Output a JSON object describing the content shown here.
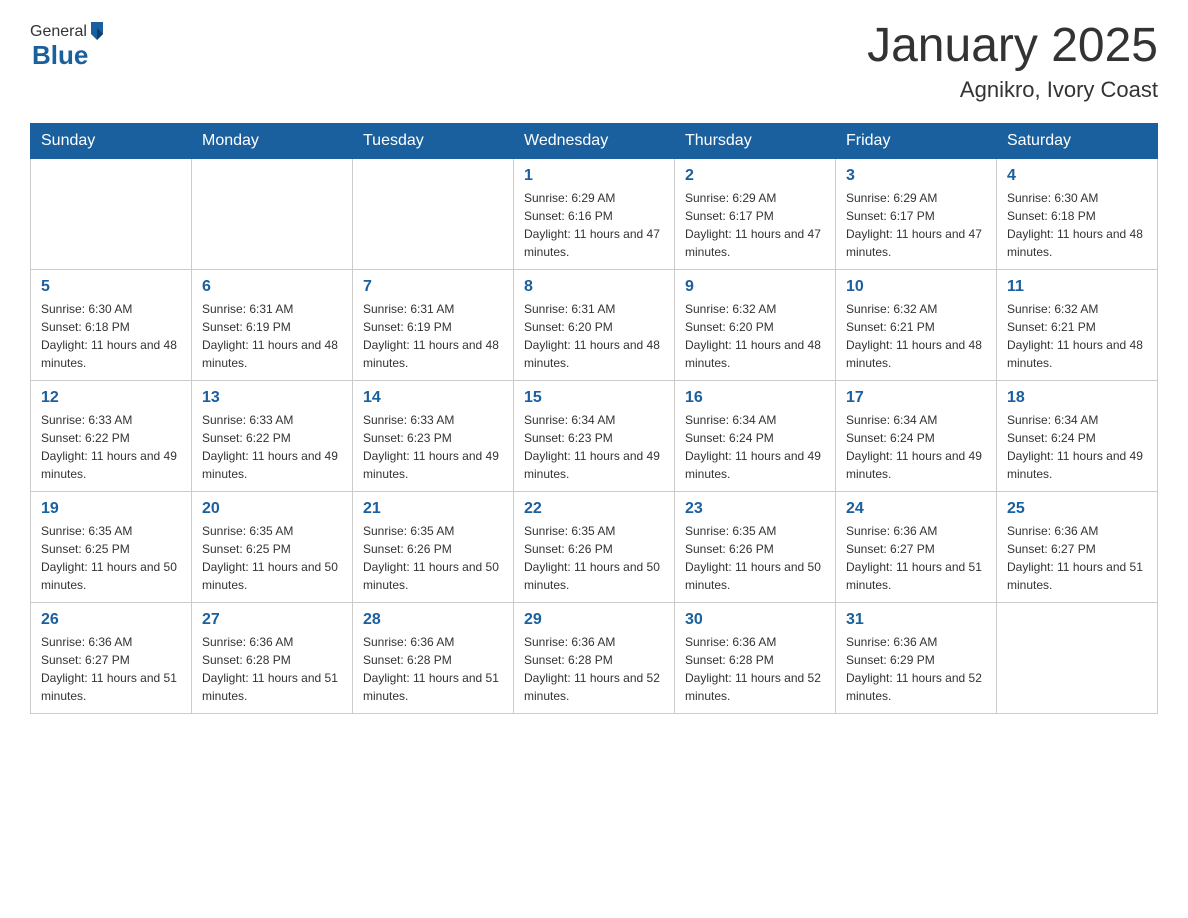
{
  "header": {
    "logo_general": "General",
    "logo_blue": "Blue",
    "title": "January 2025",
    "subtitle": "Agnikro, Ivory Coast"
  },
  "days_of_week": [
    "Sunday",
    "Monday",
    "Tuesday",
    "Wednesday",
    "Thursday",
    "Friday",
    "Saturday"
  ],
  "weeks": [
    [
      {
        "day": "",
        "info": ""
      },
      {
        "day": "",
        "info": ""
      },
      {
        "day": "",
        "info": ""
      },
      {
        "day": "1",
        "info": "Sunrise: 6:29 AM\nSunset: 6:16 PM\nDaylight: 11 hours and 47 minutes."
      },
      {
        "day": "2",
        "info": "Sunrise: 6:29 AM\nSunset: 6:17 PM\nDaylight: 11 hours and 47 minutes."
      },
      {
        "day": "3",
        "info": "Sunrise: 6:29 AM\nSunset: 6:17 PM\nDaylight: 11 hours and 47 minutes."
      },
      {
        "day": "4",
        "info": "Sunrise: 6:30 AM\nSunset: 6:18 PM\nDaylight: 11 hours and 48 minutes."
      }
    ],
    [
      {
        "day": "5",
        "info": "Sunrise: 6:30 AM\nSunset: 6:18 PM\nDaylight: 11 hours and 48 minutes."
      },
      {
        "day": "6",
        "info": "Sunrise: 6:31 AM\nSunset: 6:19 PM\nDaylight: 11 hours and 48 minutes."
      },
      {
        "day": "7",
        "info": "Sunrise: 6:31 AM\nSunset: 6:19 PM\nDaylight: 11 hours and 48 minutes."
      },
      {
        "day": "8",
        "info": "Sunrise: 6:31 AM\nSunset: 6:20 PM\nDaylight: 11 hours and 48 minutes."
      },
      {
        "day": "9",
        "info": "Sunrise: 6:32 AM\nSunset: 6:20 PM\nDaylight: 11 hours and 48 minutes."
      },
      {
        "day": "10",
        "info": "Sunrise: 6:32 AM\nSunset: 6:21 PM\nDaylight: 11 hours and 48 minutes."
      },
      {
        "day": "11",
        "info": "Sunrise: 6:32 AM\nSunset: 6:21 PM\nDaylight: 11 hours and 48 minutes."
      }
    ],
    [
      {
        "day": "12",
        "info": "Sunrise: 6:33 AM\nSunset: 6:22 PM\nDaylight: 11 hours and 49 minutes."
      },
      {
        "day": "13",
        "info": "Sunrise: 6:33 AM\nSunset: 6:22 PM\nDaylight: 11 hours and 49 minutes."
      },
      {
        "day": "14",
        "info": "Sunrise: 6:33 AM\nSunset: 6:23 PM\nDaylight: 11 hours and 49 minutes."
      },
      {
        "day": "15",
        "info": "Sunrise: 6:34 AM\nSunset: 6:23 PM\nDaylight: 11 hours and 49 minutes."
      },
      {
        "day": "16",
        "info": "Sunrise: 6:34 AM\nSunset: 6:24 PM\nDaylight: 11 hours and 49 minutes."
      },
      {
        "day": "17",
        "info": "Sunrise: 6:34 AM\nSunset: 6:24 PM\nDaylight: 11 hours and 49 minutes."
      },
      {
        "day": "18",
        "info": "Sunrise: 6:34 AM\nSunset: 6:24 PM\nDaylight: 11 hours and 49 minutes."
      }
    ],
    [
      {
        "day": "19",
        "info": "Sunrise: 6:35 AM\nSunset: 6:25 PM\nDaylight: 11 hours and 50 minutes."
      },
      {
        "day": "20",
        "info": "Sunrise: 6:35 AM\nSunset: 6:25 PM\nDaylight: 11 hours and 50 minutes."
      },
      {
        "day": "21",
        "info": "Sunrise: 6:35 AM\nSunset: 6:26 PM\nDaylight: 11 hours and 50 minutes."
      },
      {
        "day": "22",
        "info": "Sunrise: 6:35 AM\nSunset: 6:26 PM\nDaylight: 11 hours and 50 minutes."
      },
      {
        "day": "23",
        "info": "Sunrise: 6:35 AM\nSunset: 6:26 PM\nDaylight: 11 hours and 50 minutes."
      },
      {
        "day": "24",
        "info": "Sunrise: 6:36 AM\nSunset: 6:27 PM\nDaylight: 11 hours and 51 minutes."
      },
      {
        "day": "25",
        "info": "Sunrise: 6:36 AM\nSunset: 6:27 PM\nDaylight: 11 hours and 51 minutes."
      }
    ],
    [
      {
        "day": "26",
        "info": "Sunrise: 6:36 AM\nSunset: 6:27 PM\nDaylight: 11 hours and 51 minutes."
      },
      {
        "day": "27",
        "info": "Sunrise: 6:36 AM\nSunset: 6:28 PM\nDaylight: 11 hours and 51 minutes."
      },
      {
        "day": "28",
        "info": "Sunrise: 6:36 AM\nSunset: 6:28 PM\nDaylight: 11 hours and 51 minutes."
      },
      {
        "day": "29",
        "info": "Sunrise: 6:36 AM\nSunset: 6:28 PM\nDaylight: 11 hours and 52 minutes."
      },
      {
        "day": "30",
        "info": "Sunrise: 6:36 AM\nSunset: 6:28 PM\nDaylight: 11 hours and 52 minutes."
      },
      {
        "day": "31",
        "info": "Sunrise: 6:36 AM\nSunset: 6:29 PM\nDaylight: 11 hours and 52 minutes."
      },
      {
        "day": "",
        "info": ""
      }
    ]
  ]
}
